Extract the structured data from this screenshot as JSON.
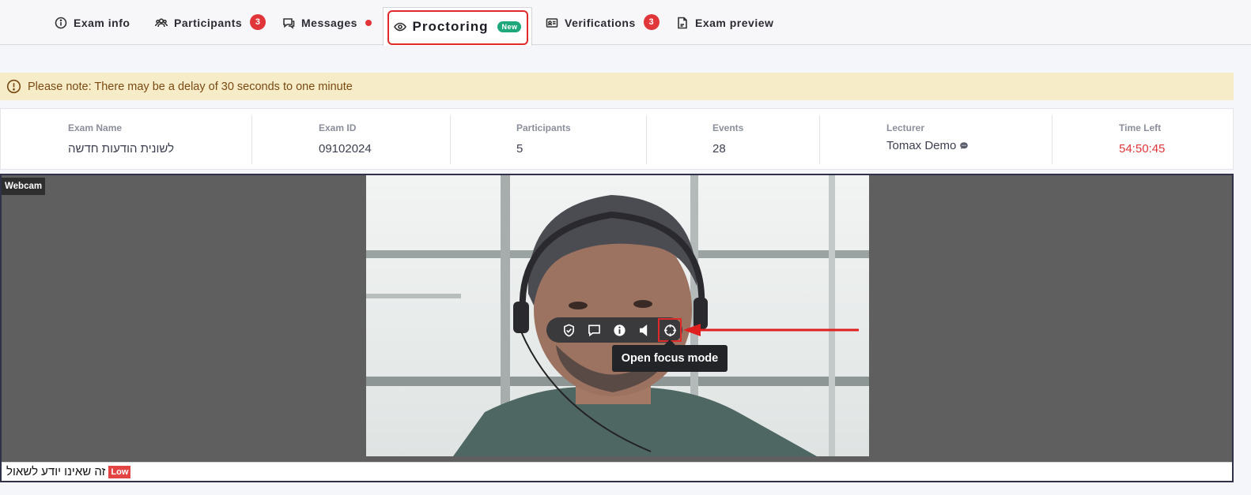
{
  "tabs": [
    {
      "label": "Exam info",
      "icon": "info-icon"
    },
    {
      "label": "Participants",
      "icon": "users-icon",
      "count": "3"
    },
    {
      "label": "Messages",
      "icon": "chat-icon",
      "dot": true
    },
    {
      "label": "Proctoring",
      "icon": "eye-icon",
      "badge": "New",
      "active": true
    },
    {
      "label": "Verifications",
      "icon": "id-card-icon",
      "count": "3"
    },
    {
      "label": "Exam preview",
      "icon": "document-icon"
    }
  ],
  "notice": {
    "text": "Please note: There may be a delay of 30 seconds to one minute"
  },
  "summary": {
    "exam_name": {
      "label": "Exam Name",
      "value": "לשונית הודעות חדשה"
    },
    "exam_id": {
      "label": "Exam ID",
      "value": "09102024"
    },
    "participants": {
      "label": "Participants",
      "value": "5"
    },
    "events": {
      "label": "Events",
      "value": "28"
    },
    "lecturer": {
      "label": "Lecturer",
      "value": "Tomax Demo"
    },
    "time_left": {
      "label": "Time Left",
      "value": "54:50:45"
    }
  },
  "webcam": {
    "tag": "Webcam",
    "caption": "זה שאינו יודע לשאול",
    "severity": "Low",
    "tooltip": "Open focus mode"
  },
  "colors": {
    "accent_red": "#e0363a",
    "new_badge": "#1ea77a",
    "notice_bg": "#f6ecc8"
  }
}
